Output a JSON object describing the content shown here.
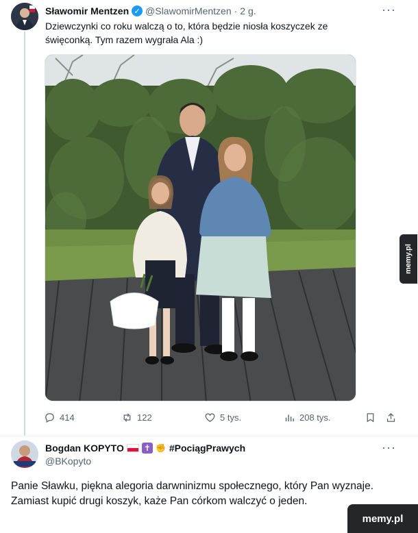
{
  "tweet": {
    "author_name": "Sławomir Mentzen",
    "handle": "@SlawomirMentzen",
    "separator": "·",
    "time": "2 g.",
    "more": "···",
    "text": "Dziewczynki co roku walczą o to, która będzie niosła koszyczek ze święconką. Tym razem wygrała Ala :)",
    "stats": {
      "replies": "414",
      "retweets": "122",
      "likes": "5 tys.",
      "views": "208 tys."
    }
  },
  "reply": {
    "author_name": "Bogdan KOPYTO",
    "hashtag": "#PociągPrawych",
    "handle": "@BKopyto",
    "more": "···",
    "text_line1": "Panie Sławku, piękna alegoria darwninizmu społecznego, który Pan wyznaje.",
    "text_line2": "Zamiast kupić drugi koszyk, każe Pan córkom walczyć o jeden."
  },
  "watermarks": {
    "side": "memy.pl",
    "corner": "memy.pl"
  },
  "icons": [
    "verified-badge-icon",
    "reply-icon",
    "retweet-icon",
    "like-icon",
    "views-icon",
    "bookmark-icon",
    "share-icon",
    "poland-flag-icon",
    "cross-emoji-icon",
    "fist-emoji-icon"
  ],
  "colors": {
    "text": "#0f1419",
    "secondary": "#536471",
    "verified": "#1d9bf0",
    "divider": "#eff3f4",
    "watermark_bg": "#25262a"
  }
}
